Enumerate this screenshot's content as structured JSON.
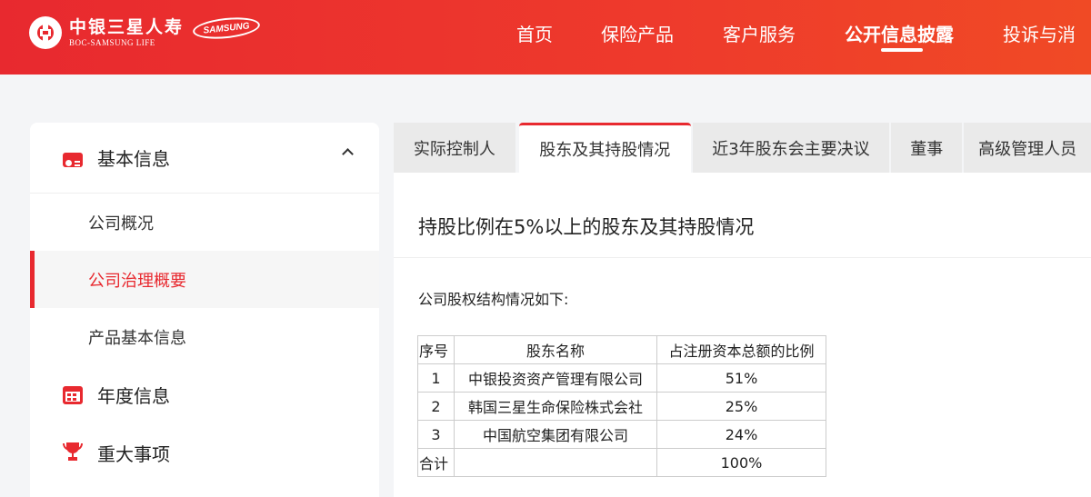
{
  "brand": {
    "name_cn": "中银三星人寿",
    "name_en": "BOC-SAMSUNG LIFE",
    "partner": "SAMSUNG",
    "accent_color": "#e8292f"
  },
  "nav": {
    "items": [
      {
        "label": "首页"
      },
      {
        "label": "保险产品"
      },
      {
        "label": "客户服务"
      },
      {
        "label": "公开信息披露",
        "active": true
      },
      {
        "label": "投诉与消"
      }
    ]
  },
  "sidebar": {
    "groups": [
      {
        "label": "基本信息",
        "icon": "id-card-icon",
        "expanded": true,
        "items": [
          {
            "label": "公司概况"
          },
          {
            "label": "公司治理概要",
            "active": true
          },
          {
            "label": "产品基本信息"
          }
        ]
      },
      {
        "label": "年度信息",
        "icon": "calendar-icon"
      },
      {
        "label": "重大事项",
        "icon": "trophy-icon"
      }
    ]
  },
  "tabs": [
    {
      "label": "实际控制人"
    },
    {
      "label": "股东及其持股情况",
      "active": true
    },
    {
      "label": "近3年股东会主要决议"
    },
    {
      "label": "董事"
    },
    {
      "label": "高级管理人员"
    }
  ],
  "panel": {
    "title": "持股比例在5%以上的股东及其持股情况",
    "intro": "公司股权结构情况如下:",
    "table": {
      "headers": [
        "序号",
        "股东名称",
        "占注册资本总额的比例"
      ],
      "rows": [
        [
          "1",
          "中银投资资产管理有限公司",
          "51%"
        ],
        [
          "2",
          "韩国三星生命保险株式会社",
          "25%"
        ],
        [
          "3",
          "中国航空集团有限公司",
          "24%"
        ]
      ],
      "total": [
        "合计",
        "",
        "100%"
      ]
    }
  }
}
